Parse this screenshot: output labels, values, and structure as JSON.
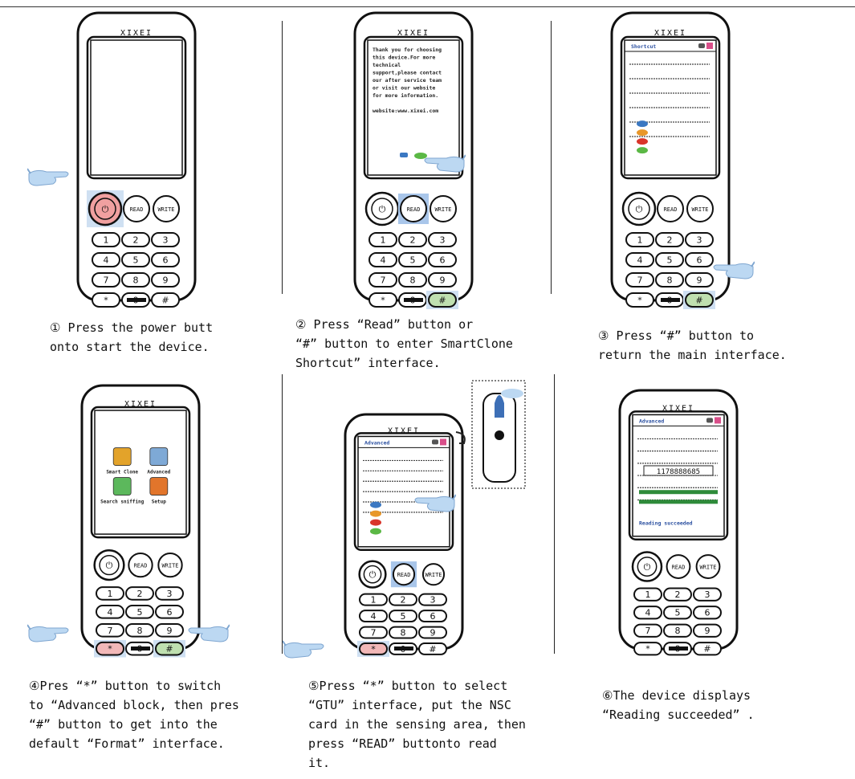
{
  "device": {
    "brand": "XIXEI",
    "read_key": "READ",
    "write_key": "WRITE",
    "keys": [
      "1",
      "2",
      "3",
      "4",
      "5",
      "6",
      "7",
      "8",
      "9",
      "*",
      "0",
      "#"
    ]
  },
  "steps": [
    {
      "caption": "① Press the power butt\nonto start the device.",
      "screen": "blank"
    },
    {
      "caption": "②  Press “Read” button or\n“#” button to enter SmartClone\nShortcut” interface.",
      "screen": "text",
      "screen_text": "Thank you for choosing\nthis device.For more\ntechnical\nsupport,please contact\nour after service team\nor visit our website\nfor more information.\n\nwebsite:www.xixei.com"
    },
    {
      "caption": "③ Press  “#”  button to\nreturn the main interface.",
      "screen": "shortcut",
      "title": "Shortcut"
    },
    {
      "caption": "④Pres “*” button to switch\n to “Advanced block, then pres\n “#” button to get into the\ndefault “Format” interface.",
      "screen": "menu",
      "menu": [
        "Smart Clone",
        "Advanced",
        "Search sniffing",
        "Setup"
      ]
    },
    {
      "caption": "⑤Press “*” button to select\n “GTU” interface, put the NSC\ncard in the sensing area, then\npress  “READ”  buttonto read\nit.",
      "screen": "advanced",
      "title": "Advanced"
    },
    {
      "caption": "⑥The device displays\n “Reading succeeded” .",
      "screen": "result",
      "title": "Advanced",
      "uid": "1178888685",
      "status": "Reading succeeded"
    }
  ]
}
